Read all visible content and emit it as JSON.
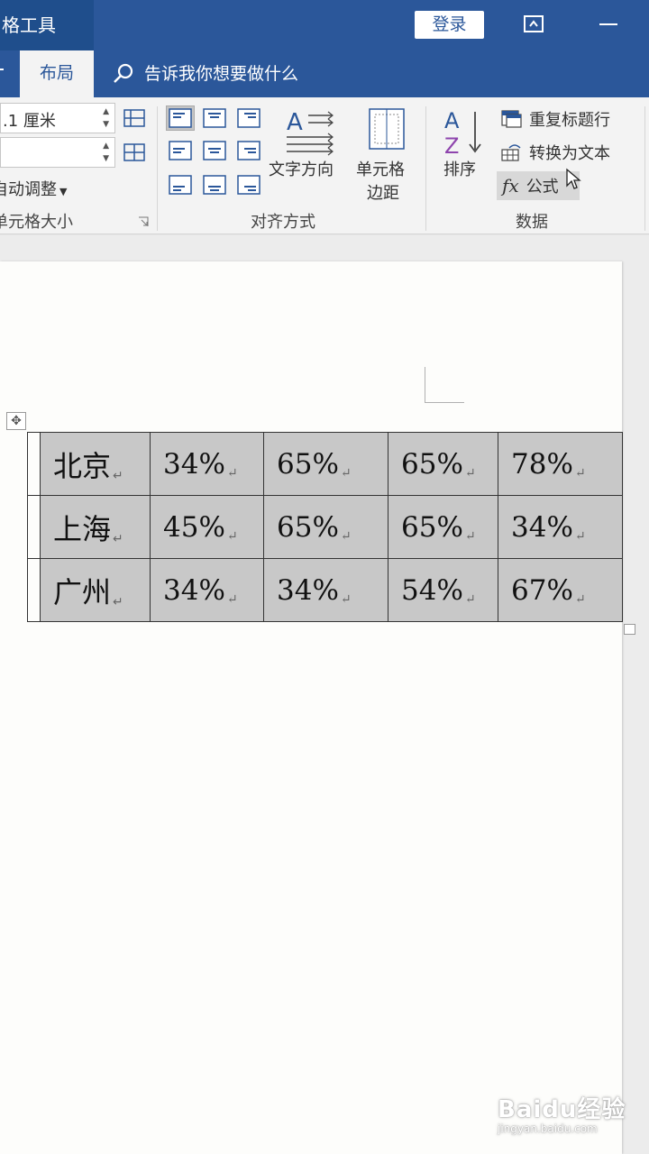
{
  "titlebar": {
    "context_tab": "格工具",
    "login": "登录"
  },
  "tabs": {
    "active": "布局",
    "tell_me": "告诉我你想要做什么"
  },
  "ribbon": {
    "cell_size": {
      "height_value": ".1 厘米",
      "width_value": "",
      "autofit": "自动调整",
      "group_label": "单元格大小"
    },
    "alignment": {
      "text_direction": "文字方向",
      "cell_margins_line1": "单元格",
      "cell_margins_line2": "边距",
      "group_label": "对齐方式"
    },
    "data": {
      "sort": "排序",
      "repeat_header": "重复标题行",
      "convert_text": "转换为文本",
      "formula": "公式",
      "group_label": "数据"
    }
  },
  "table": {
    "rows": [
      {
        "city": "北京",
        "values": [
          "34%",
          "65%",
          "65%",
          "78%"
        ]
      },
      {
        "city": "上海",
        "values": [
          "45%",
          "65%",
          "65%",
          "34%"
        ]
      },
      {
        "city": "广州",
        "values": [
          "34%",
          "34%",
          "54%",
          "67%"
        ]
      }
    ]
  },
  "watermark": {
    "main": "Baidu经验",
    "sub": "jingyan.baidu.com"
  },
  "colors": {
    "brand_blue": "#2b579a",
    "ribbon_bg": "#f3f3f3",
    "selected_cells": "#c8c8c8"
  }
}
